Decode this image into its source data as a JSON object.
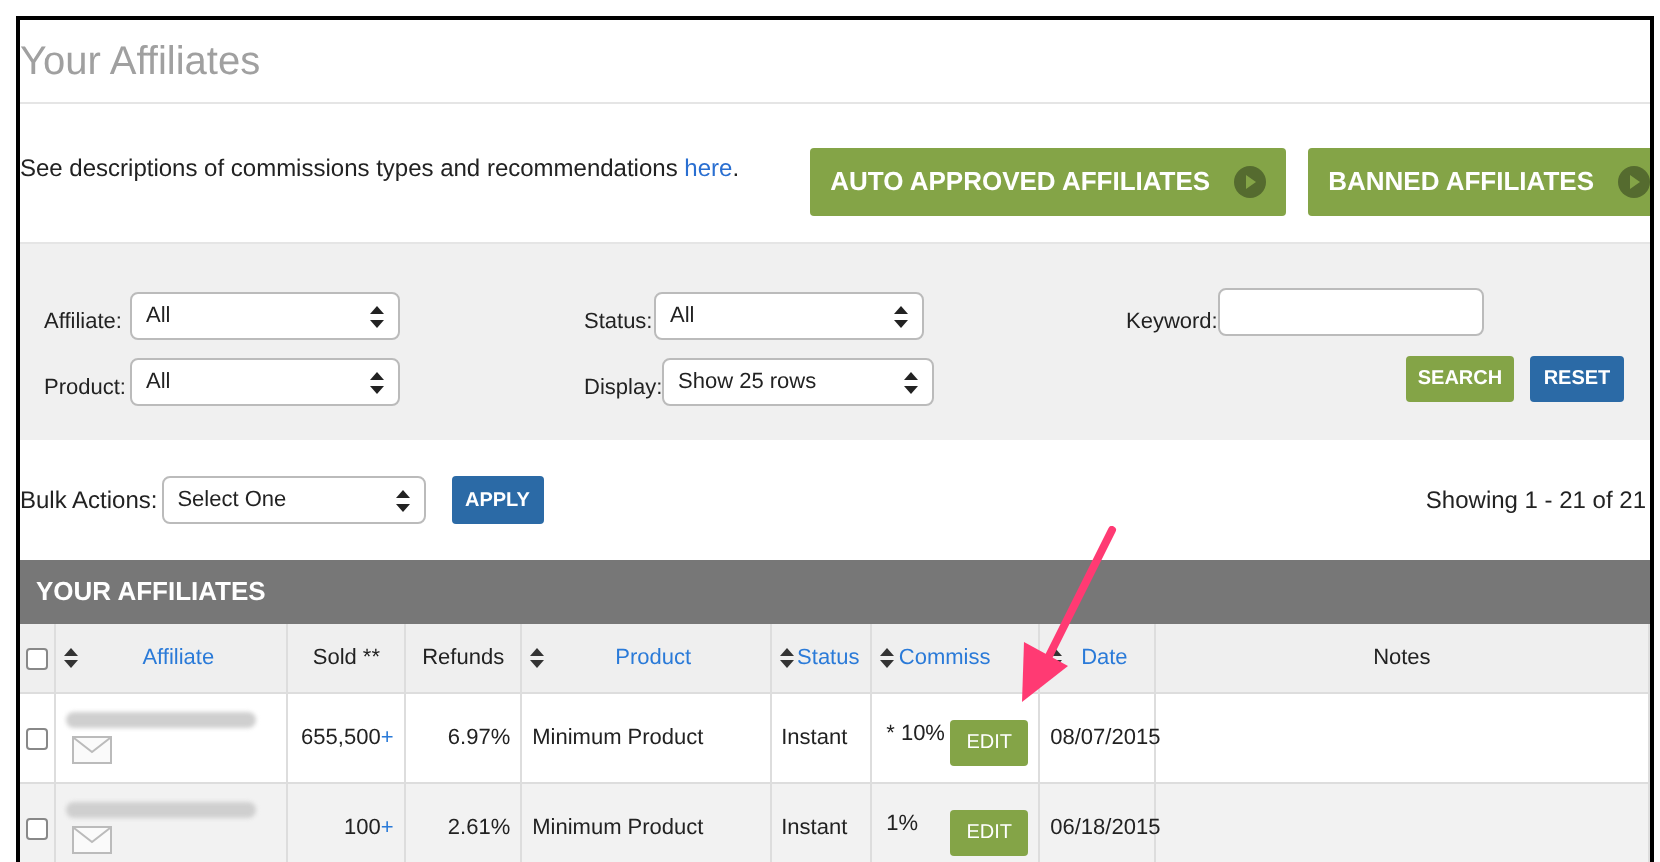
{
  "title": "Your Affiliates",
  "description": {
    "text": "See descriptions of commissions types and recommendations ",
    "link": "here",
    "after": "."
  },
  "top_buttons": [
    "AUTO APPROVED AFFILIATES",
    "BANNED AFFILIATES"
  ],
  "filters": {
    "affiliate": {
      "label": "Affiliate:",
      "value": "All"
    },
    "status": {
      "label": "Status:",
      "value": "All"
    },
    "keyword": {
      "label": "Keyword:"
    },
    "product": {
      "label": "Product:",
      "value": "All"
    },
    "display": {
      "label": "Display:",
      "value": "Show 25 rows"
    },
    "buttons": [
      "SEARCH",
      "RESET"
    ]
  },
  "bulk": {
    "label": "Bulk Actions:",
    "value": "Select One",
    "button": "APPLY"
  },
  "showing": "Showing 1 - 21 of 21",
  "table": {
    "title": "YOUR AFFILIATES",
    "all_checked": false,
    "columns": [
      {
        "label": "Affiliate",
        "sortable": true
      },
      {
        "label": "Sold **",
        "sortable": false
      },
      {
        "label": "Refunds",
        "sortable": false
      },
      {
        "label": "Product",
        "sortable": true
      },
      {
        "label": "Status",
        "sortable": true
      },
      {
        "label": "Commiss",
        "sortable": true
      },
      {
        "label": "Date",
        "sortable": true
      },
      {
        "label": "Notes",
        "sortable": false
      }
    ],
    "rows": [
      {
        "checked": false,
        "sold": "655,500",
        "sold_suffix": "+",
        "refunds": "6.97%",
        "product": "Minimum Product",
        "status": "Instant",
        "commission": "* 10%",
        "edit": "EDIT",
        "date": "08/07/2015"
      },
      {
        "checked": false,
        "sold": "100",
        "sold_suffix": "+",
        "refunds": "2.61%",
        "product": "Minimum Product",
        "status": "Instant",
        "commission": "1%",
        "edit": "EDIT",
        "date": "06/18/2015"
      }
    ]
  }
}
